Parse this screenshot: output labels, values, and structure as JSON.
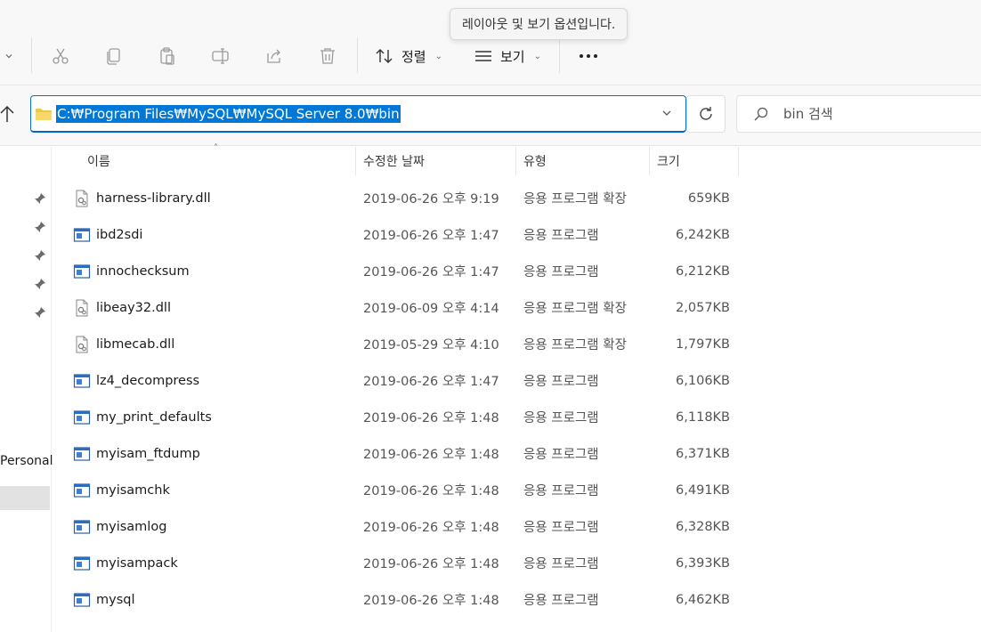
{
  "toolbar": {
    "sort_label": "정렬",
    "view_label": "보기",
    "tooltip": "레이아웃 및 보기 옵션입니다."
  },
  "address": {
    "path": "C:₩Program Files₩MySQL₩MySQL Server 8.0₩bin",
    "search_placeholder": "bin 검색"
  },
  "nav": {
    "personal_label": "Personal"
  },
  "columns": {
    "name": "이름",
    "date": "수정한 날짜",
    "type": "유형",
    "size": "크기"
  },
  "files": [
    {
      "name": "harness-library.dll",
      "date": "2019-06-26 오후 9:19",
      "type": "응용 프로그램 확장",
      "size": "659KB",
      "icon": "dll-icon"
    },
    {
      "name": "ibd2sdi",
      "date": "2019-06-26 오후 1:47",
      "type": "응용 프로그램",
      "size": "6,242KB",
      "icon": "exe-icon"
    },
    {
      "name": "innochecksum",
      "date": "2019-06-26 오후 1:47",
      "type": "응용 프로그램",
      "size": "6,212KB",
      "icon": "exe-icon"
    },
    {
      "name": "libeay32.dll",
      "date": "2019-06-09 오후 4:14",
      "type": "응용 프로그램 확장",
      "size": "2,057KB",
      "icon": "dll-icon"
    },
    {
      "name": "libmecab.dll",
      "date": "2019-05-29 오후 4:10",
      "type": "응용 프로그램 확장",
      "size": "1,797KB",
      "icon": "dll-icon"
    },
    {
      "name": "lz4_decompress",
      "date": "2019-06-26 오후 1:47",
      "type": "응용 프로그램",
      "size": "6,106KB",
      "icon": "exe-icon"
    },
    {
      "name": "my_print_defaults",
      "date": "2019-06-26 오후 1:48",
      "type": "응용 프로그램",
      "size": "6,118KB",
      "icon": "exe-icon"
    },
    {
      "name": "myisam_ftdump",
      "date": "2019-06-26 오후 1:48",
      "type": "응용 프로그램",
      "size": "6,371KB",
      "icon": "exe-icon"
    },
    {
      "name": "myisamchk",
      "date": "2019-06-26 오후 1:48",
      "type": "응용 프로그램",
      "size": "6,491KB",
      "icon": "exe-icon"
    },
    {
      "name": "myisamlog",
      "date": "2019-06-26 오후 1:48",
      "type": "응용 프로그램",
      "size": "6,328KB",
      "icon": "exe-icon"
    },
    {
      "name": "myisampack",
      "date": "2019-06-26 오후 1:48",
      "type": "응용 프로그램",
      "size": "6,393KB",
      "icon": "exe-icon"
    },
    {
      "name": "mysql",
      "date": "2019-06-26 오후 1:48",
      "type": "응용 프로그램",
      "size": "6,462KB",
      "icon": "exe-icon"
    }
  ],
  "colors": {
    "accent": "#0078d7",
    "toolbar_bg": "#f8f8f8"
  }
}
